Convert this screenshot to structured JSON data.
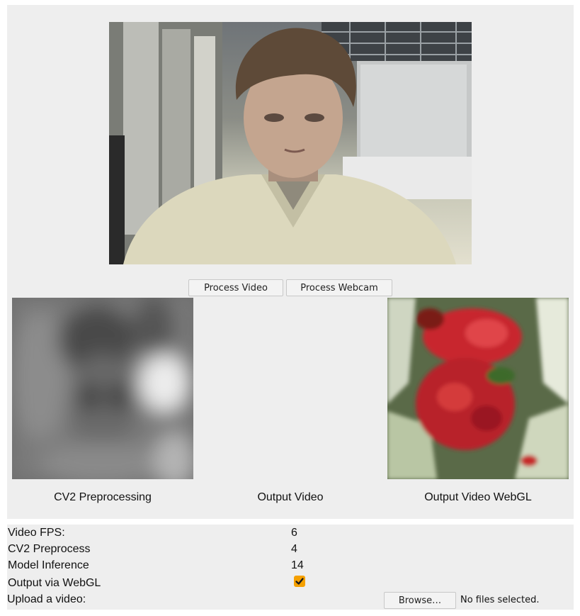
{
  "controls": {
    "process_video_label": "Process Video",
    "process_webcam_label": "Process Webcam"
  },
  "outputs": {
    "cv2_caption": "CV2 Preprocessing",
    "output_video_caption": "Output Video",
    "output_webgl_caption": "Output Video WebGL"
  },
  "stats": {
    "video_fps_label": "Video FPS:",
    "video_fps_value": "6",
    "cv2_preprocess_label": "CV2 Preprocess",
    "cv2_preprocess_value": "4",
    "model_inference_label": "Model Inference",
    "model_inference_value": "14",
    "webgl_label": "Output via WebGL",
    "webgl_checked": true,
    "upload_label": "Upload a video:",
    "browse_label": "Browse…",
    "file_status": "No files selected."
  },
  "colors": {
    "panel_bg": "#eeeeee",
    "checkbox_accent": "#f5a000"
  },
  "icons": {
    "checkbox": "checkmark-icon"
  }
}
